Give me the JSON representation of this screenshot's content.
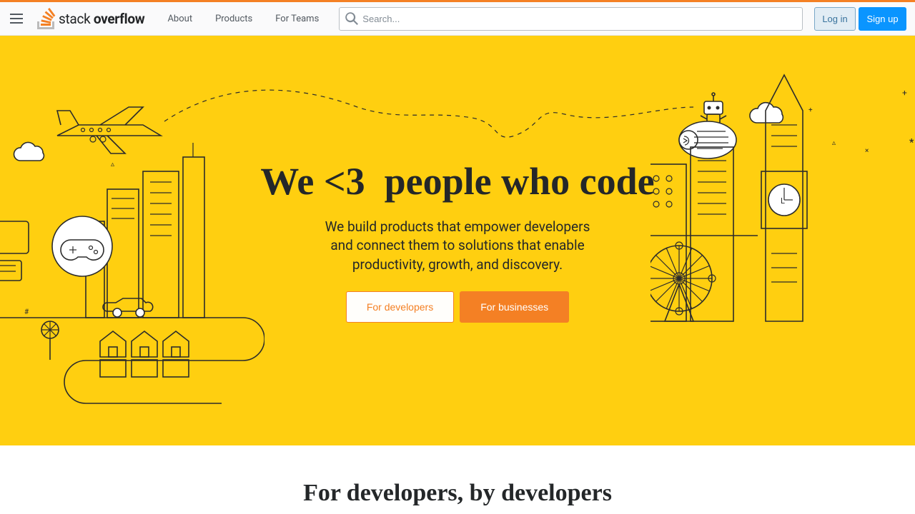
{
  "header": {
    "logo": {
      "light": "stack",
      "bold": "overflow"
    },
    "nav": {
      "about": "About",
      "products": "Products",
      "for_teams": "For Teams"
    },
    "search_placeholder": "Search...",
    "login": "Log in",
    "signup": "Sign up"
  },
  "hero": {
    "headline_prefix": "We <3 ",
    "headline_typed": "people who code",
    "subtitle": "We build products that empower developers and connect them to solutions that enable productivity, growth, and discovery.",
    "cta_dev": "For developers",
    "cta_biz": "For businesses"
  },
  "section2": {
    "title": "For developers, by developers"
  },
  "colors": {
    "accent": "#f48024",
    "hero_bg": "#ffcf10",
    "primary_blue": "#0a95ff"
  }
}
